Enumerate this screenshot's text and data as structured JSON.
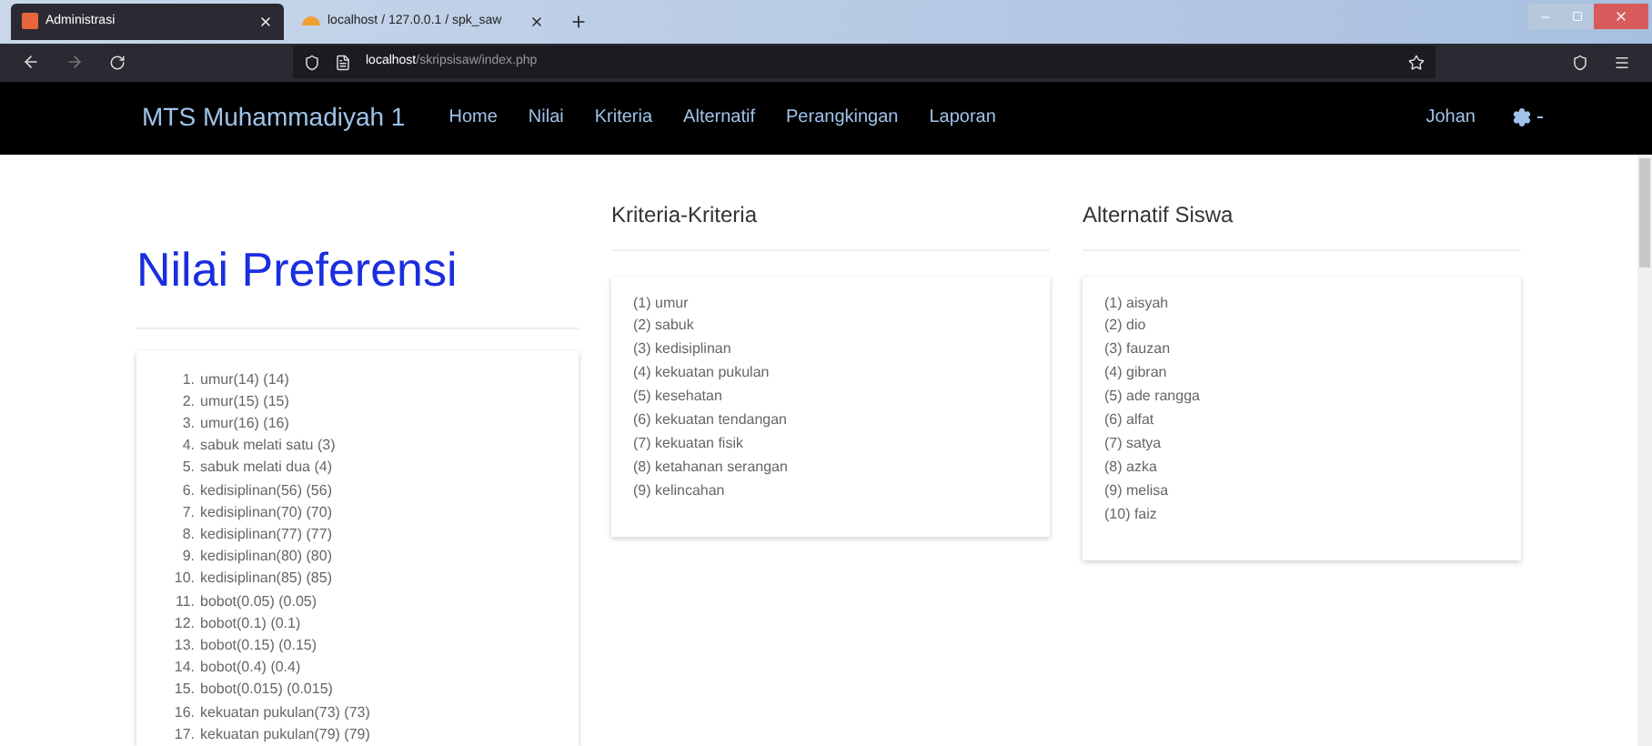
{
  "browser": {
    "tabs": [
      {
        "title": "Administrasi",
        "selected": true
      },
      {
        "title": "localhost / 127.0.0.1 / spk_saw",
        "selected": false
      }
    ],
    "address": {
      "host": "localhost",
      "path": "/skripsisaw/index.php"
    }
  },
  "navbar": {
    "brand": "MTS Muhammadiyah 1",
    "links": [
      "Home",
      "Nilai",
      "Kriteria",
      "Alternatif",
      "Perangkingan",
      "Laporan"
    ],
    "user": "Johan"
  },
  "preferensi": {
    "title": "Nilai Preferensi",
    "items": [
      {
        "number": "1.",
        "label": "umur(14) (14)"
      },
      {
        "number": "2.",
        "label": "umur(15) (15)"
      },
      {
        "number": "3.",
        "label": "umur(16) (16)"
      },
      {
        "number": "4.",
        "label": "sabuk melati satu (3)"
      },
      {
        "number": "5.",
        "label": "sabuk melati dua (4)"
      },
      {
        "number": "6.",
        "label": "kedisiplinan(56) (56)"
      },
      {
        "number": "7.",
        "label": "kedisiplinan(70) (70)"
      },
      {
        "number": "8.",
        "label": "kedisiplinan(77) (77)"
      },
      {
        "number": "9.",
        "label": "kedisiplinan(80) (80)"
      },
      {
        "number": "10.",
        "label": "kedisiplinan(85) (85)"
      },
      {
        "number": "11.",
        "label": "bobot(0.05) (0.05)"
      },
      {
        "number": "12.",
        "label": "bobot(0.1) (0.1)"
      },
      {
        "number": "13.",
        "label": "bobot(0.15) (0.15)"
      },
      {
        "number": "14.",
        "label": "bobot(0.4) (0.4)"
      },
      {
        "number": "15.",
        "label": "bobot(0.015) (0.015)"
      },
      {
        "number": "16.",
        "label": "kekuatan pukulan(73) (73)"
      },
      {
        "number": "17.",
        "label": "kekuatan pukulan(79) (79)"
      }
    ]
  },
  "kriteria": {
    "title": "Kriteria-Kriteria",
    "items": [
      "(1) umur",
      "(2) sabuk",
      "(3) kedisiplinan",
      "(4) kekuatan pukulan",
      "(5) kesehatan",
      "(6) kekuatan tendangan",
      "(7) kekuatan fisik",
      "(8) ketahanan serangan",
      "(9) kelincahan"
    ]
  },
  "alternatif": {
    "title": "Alternatif Siswa",
    "items": [
      "(1) aisyah",
      "(2) dio",
      "(3) fauzan",
      "(4) gibran",
      "(5) ade rangga",
      "(6) alfat",
      "(7) satya",
      "(8) azka",
      "(9) melisa",
      "(10) faiz"
    ]
  }
}
